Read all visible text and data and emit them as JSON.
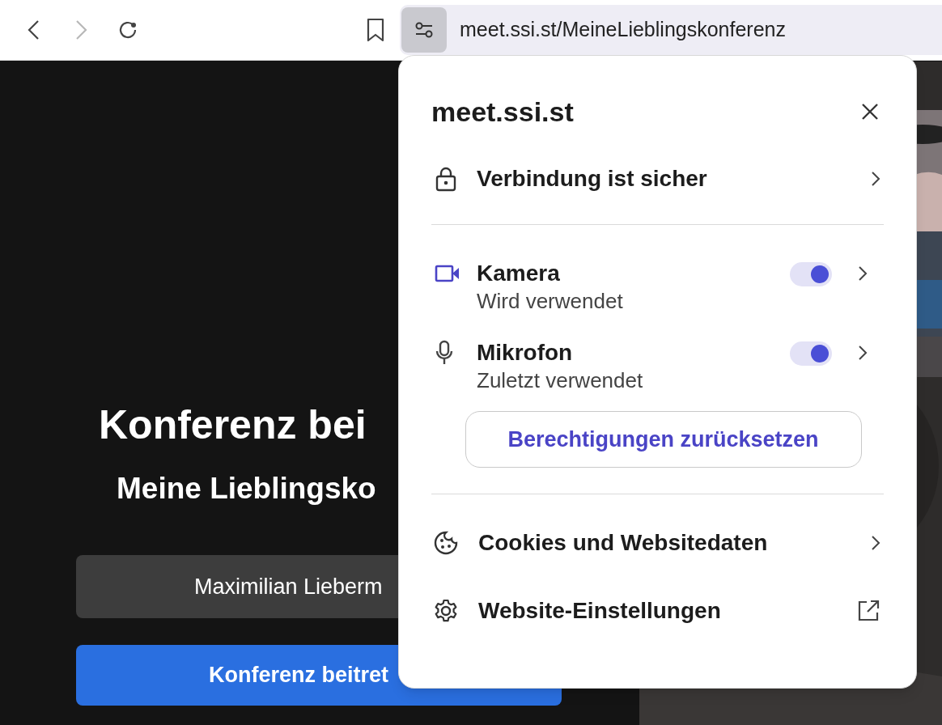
{
  "toolbar": {
    "nav": [
      {
        "kind": "back",
        "disabled": false
      },
      {
        "kind": "forward",
        "disabled": true
      },
      {
        "kind": "reload",
        "disabled": false
      }
    ],
    "address": "meet.ssi.st/MeineLieblingskonferenz"
  },
  "page": {
    "heading": "Konferenz bei",
    "subheading": "Meine Lieblingsko",
    "name_field": {
      "value": "Maximilian Lieberm"
    },
    "join_button": "Konferenz beitret"
  },
  "site_info": {
    "title": "meet.ssi.st",
    "connection": "Verbindung ist sicher",
    "permissions": [
      {
        "kind": "camera",
        "label": "Kamera",
        "status": "Wird verwendet",
        "in_use": true,
        "on": true
      },
      {
        "kind": "microphone",
        "label": "Mikrofon",
        "status": "Zuletzt verwendet",
        "in_use": false,
        "on": true
      }
    ],
    "reset_button": "Berechtigungen zurücksetzen",
    "links": [
      {
        "kind": "cookies",
        "label": "Cookies und Websitedaten"
      },
      {
        "kind": "settings",
        "label": "Website-Einstellungen"
      }
    ]
  }
}
